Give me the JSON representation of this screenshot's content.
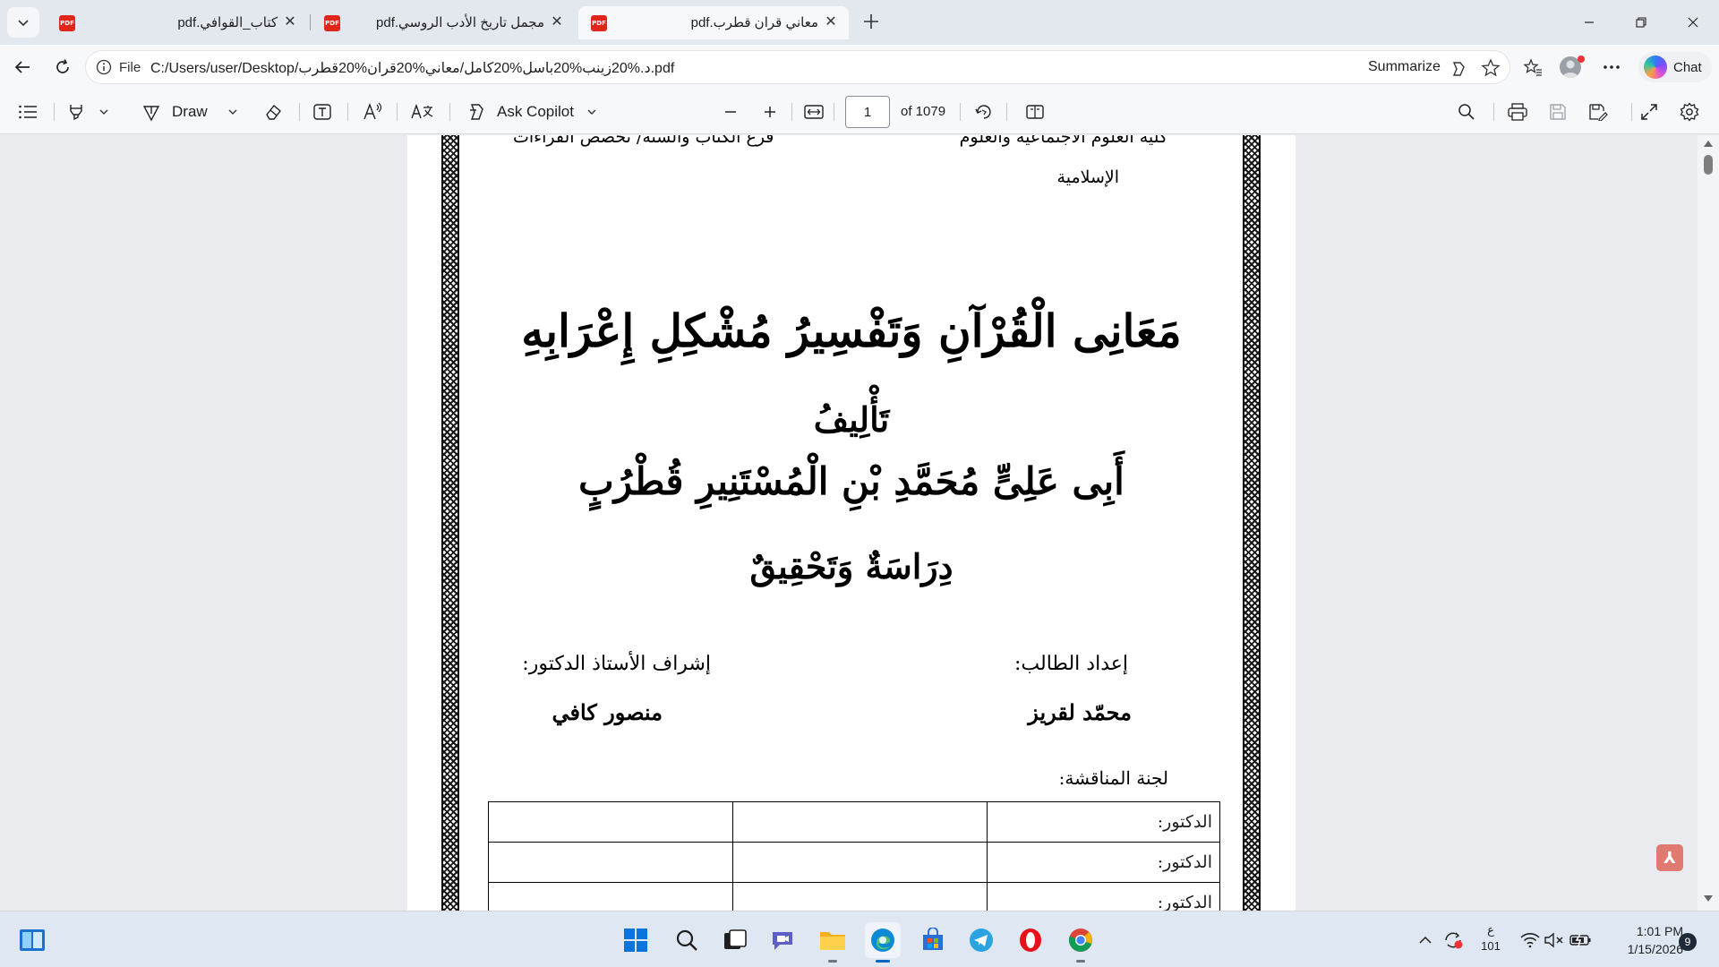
{
  "tabs": [
    {
      "title": "كتاب_القوافي.pdf",
      "active": false
    },
    {
      "title": "مجمل تاريخ الأدب الروسي.pdf",
      "active": false
    },
    {
      "title": "معاني قران قطرب.pdf",
      "active": true
    }
  ],
  "address": {
    "scheme": "File",
    "url": "C:/Users/user/Desktop/د.%20زينب%20باسل%20كامل/معاني%20قران%20قطرب.pdf",
    "summarize": "Summarize"
  },
  "chat_label": "Chat",
  "pdf_toolbar": {
    "draw_label": "Draw",
    "ask_copilot_label": "Ask Copilot",
    "page_number": "1",
    "page_count_label": "of 1079"
  },
  "document": {
    "institution_left": "فرع الكتاب والسنة/ تخصص القراءات",
    "institution_right": "كلية العلوم الاجتماعية والعلوم",
    "institution_right_line2": "الإسلامية",
    "title": "مَعَانِى الْقُرْآنِ وَتَفْسِيرُ مُشْكِلِ إِعْرَابِهِ",
    "authorship_label": "تَأْلِيفُ",
    "author": "أَبِى عَلِىٍّ مُحَمَّدِ بْنِ الْمُسْتَنِيرِ قُطْرُبٍ",
    "study_label": "دِرَاسَةٌ وَتَحْقِيقٌ",
    "prepared_by_label": "إعداد الطالب:",
    "prepared_by_name": "محمّد لقريز",
    "supervisor_label": "إشراف الأستاذ الدكتور:",
    "supervisor_name": "منصور كافي",
    "committee_label": "لجنة المناقشة:",
    "committee_rows": [
      "الدكتور:",
      "الدكتور:",
      "الدكتور:"
    ]
  },
  "taskbar": {
    "language_line1": "ع",
    "language_line2": "101",
    "time": "1:01 PM",
    "date": "1/15/2026",
    "notification_count": "9"
  },
  "colors": {
    "pdf_icon": "#e1251b",
    "edge_blue": "#0067c0"
  }
}
